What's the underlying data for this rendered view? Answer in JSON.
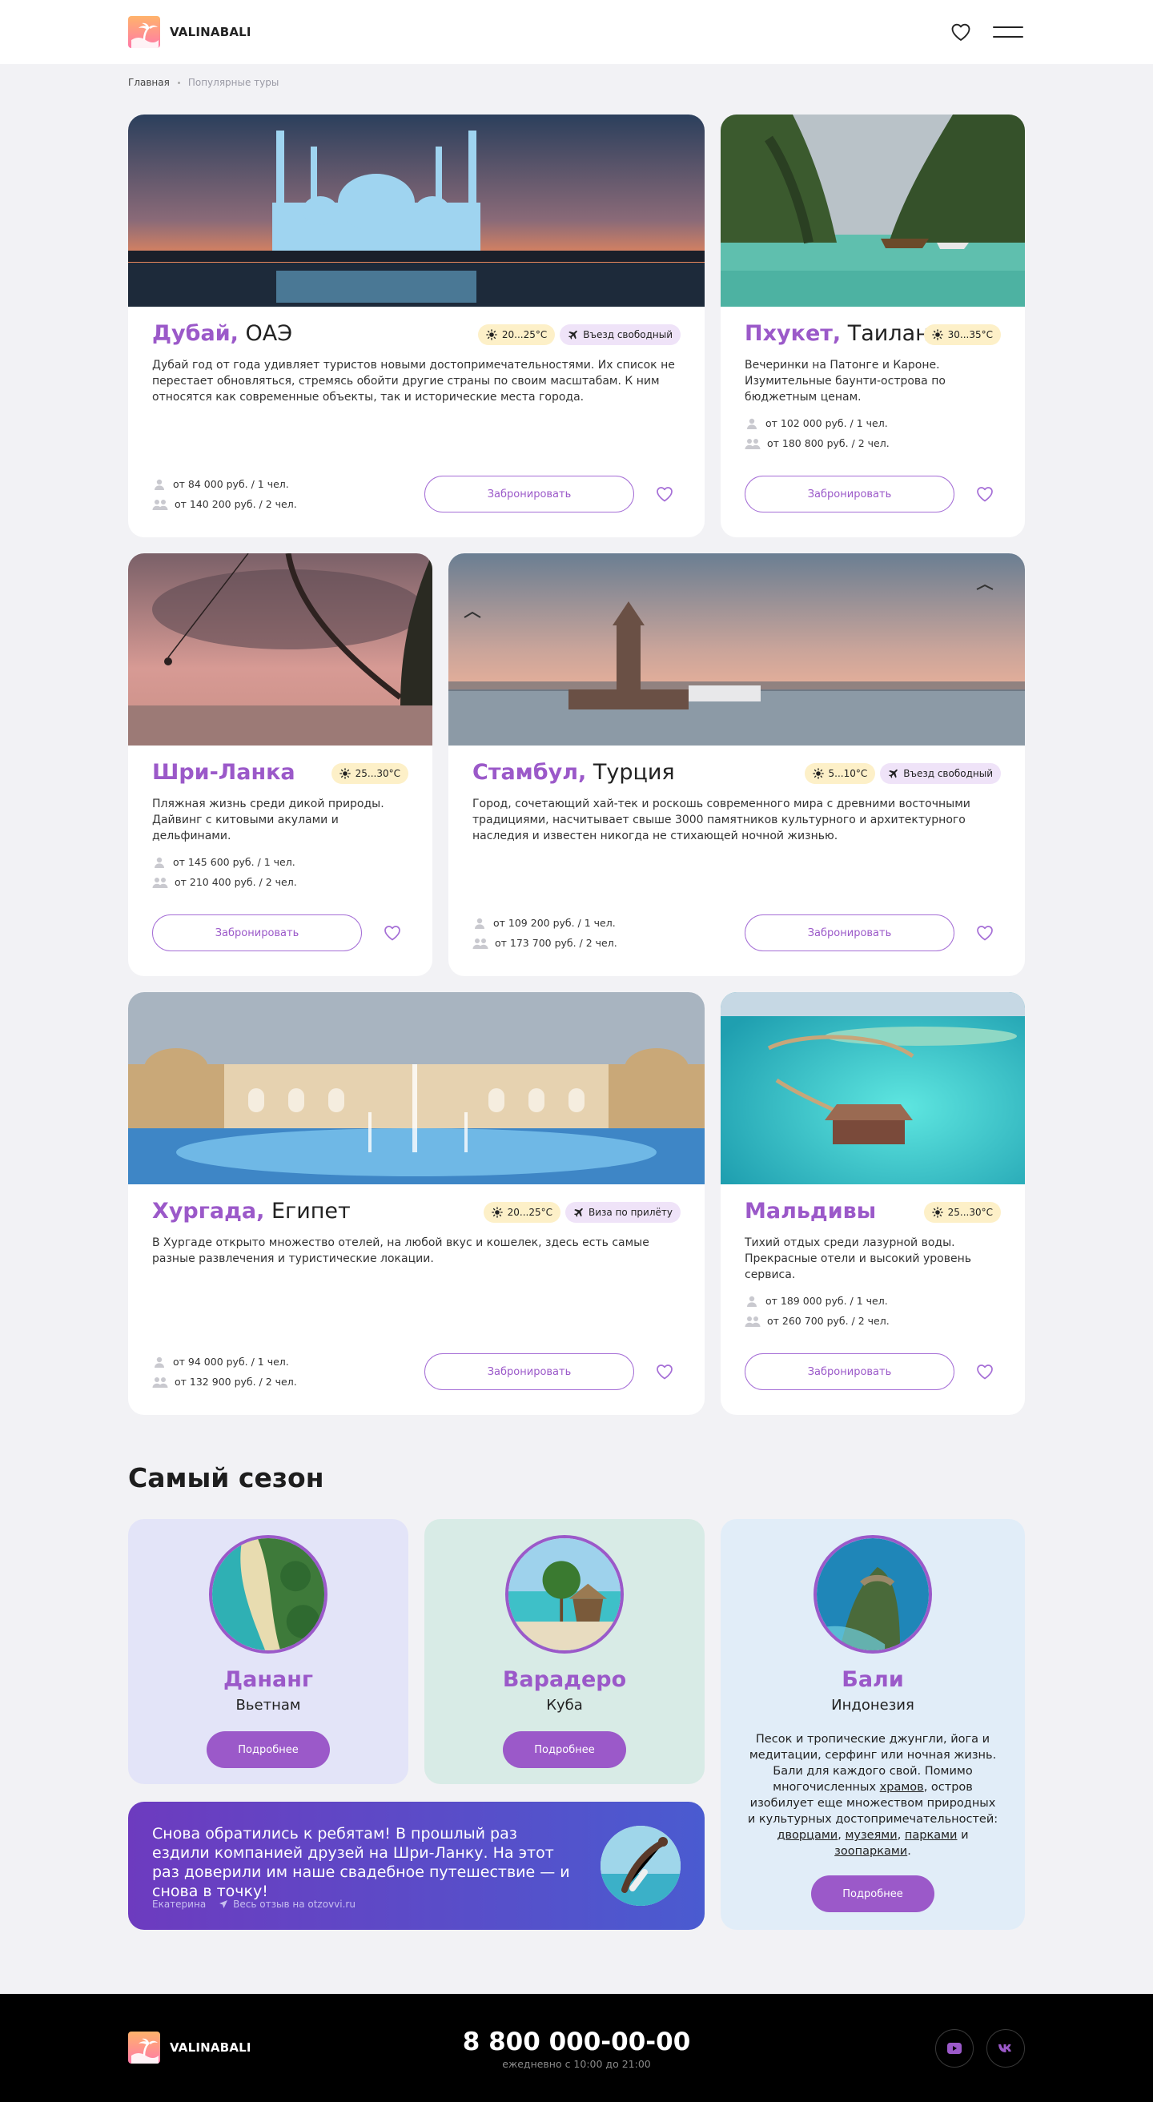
{
  "brand": {
    "name": "VALINABALI"
  },
  "header": {
    "favorites_icon": "heart-icon",
    "menu_icon": "hamburger-icon"
  },
  "breadcrumb": {
    "home": "Главная",
    "current": "Популярные туры"
  },
  "tours": [
    {
      "city": "Дубай,",
      "country": "ОАЭ",
      "temp": "20...25°C",
      "visa": "Въезд свободный",
      "desc": "Дубай год от года удивляет туристов новыми достопримечательностями. Их список не перестает обновляться, стремясь обойти другие страны по своим масштабам. К ним относятся как современные объекты, так и исторические места города.",
      "price1": "от 84 000 руб. / 1 чел.",
      "price2": "от 140 200 руб. / 2 чел.",
      "book": "Забронировать"
    },
    {
      "city": "Пхукет,",
      "country": "Таиланд",
      "temp": "30...35°C",
      "desc": "Вечеринки на Патонге и Кароне. Изумительные баунти-острова по бюджетным ценам.",
      "price1": "от 102 000 руб. / 1 чел.",
      "price2": "от 180 800 руб. / 2 чел.",
      "book": "Забронировать"
    },
    {
      "city": "Шри-Ланка",
      "country": "",
      "temp": "25...30°C",
      "desc": "Пляжная жизнь среди дикой природы. Дайвинг с китовыми акулами и дельфинами.",
      "price1": "от 145 600 руб. / 1 чел.",
      "price2": "от 210 400 руб. / 2 чел.",
      "book": "Забронировать"
    },
    {
      "city": "Стамбул,",
      "country": "Турция",
      "temp": "5...10°C",
      "visa": "Въезд свободный",
      "desc": "Город, сочетающий хай-тек и роскошь современного мира с древними восточными традициями, насчитывает свыше 3000 памятников культурного и архитектурного наследия и известен никогда не стихающей ночной жизнью.",
      "price1": "от 109 200 руб. / 1 чел.",
      "price2": "от 173 700 руб. / 2 чел.",
      "book": "Забронировать"
    },
    {
      "city": "Хургада,",
      "country": "Египет",
      "temp": "20...25°C",
      "visa": "Виза по прилёту",
      "desc": "В Хургаде открыто множество отелей, на любой вкус и кошелек, здесь есть самые разные развлечения и туристические локации.",
      "price1": "от 94 000 руб. / 1 чел.",
      "price2": "от 132 900 руб. / 2 чел.",
      "book": "Забронировать"
    },
    {
      "city": "Мальдивы",
      "country": "",
      "temp": "25...30°C",
      "desc": "Тихий отдых среди лазурной воды. Прекрасные отели и высокий уровень сервиса.",
      "price1": "от 189 000 руб. / 1 чел.",
      "price2": "от 260 700 руб. / 2 чел.",
      "book": "Забронировать"
    }
  ],
  "season": {
    "title": "Самый сезон",
    "cards": [
      {
        "city": "Дананг",
        "country": "Вьетнам",
        "button": "Подробнее",
        "bg": "#e3e4f8"
      },
      {
        "city": "Варадеро",
        "country": "Куба",
        "button": "Подробнее",
        "bg": "#d8ebe6"
      },
      {
        "city": "Бали",
        "country": "Индонезия",
        "button": "Подробнее",
        "bg": "#e1edf8",
        "text_1": "Песок и тропические джунгли, йога и медитации, серфинг или ночная жизнь. Бали для каждого свой. Помимо многочисленных",
        "link_1": "храмов",
        "text_2": ", остров изобилует еще множеством природных и культурных достопримечательностей:",
        "link_2": "дворцами",
        "sep_1": ",",
        "link_3": "музеями",
        "sep_2": ",",
        "link_4": "парками",
        "sep_3": "и",
        "link_5": "зоопарками",
        "end": "."
      }
    ]
  },
  "review": {
    "text": "Снова обратились к ребятам! В прошлый раз ездили компанией друзей на Шри-Ланку. На этот раз доверили им наше свадебное путешествие — и снова в точку!",
    "author": "Екатерина",
    "source": "Весь отзыв на otzovvi.ru"
  },
  "footer": {
    "phone": "8 800 000-00-00",
    "hours": "ежедневно с 10:00 до 21:00",
    "social": [
      "youtube-icon",
      "vk-icon"
    ]
  },
  "colors": {
    "accent": "#9b59c9",
    "weather_tag": "#fdf0c8",
    "visa_tag": "#efe3f8",
    "footer": "#000000"
  }
}
